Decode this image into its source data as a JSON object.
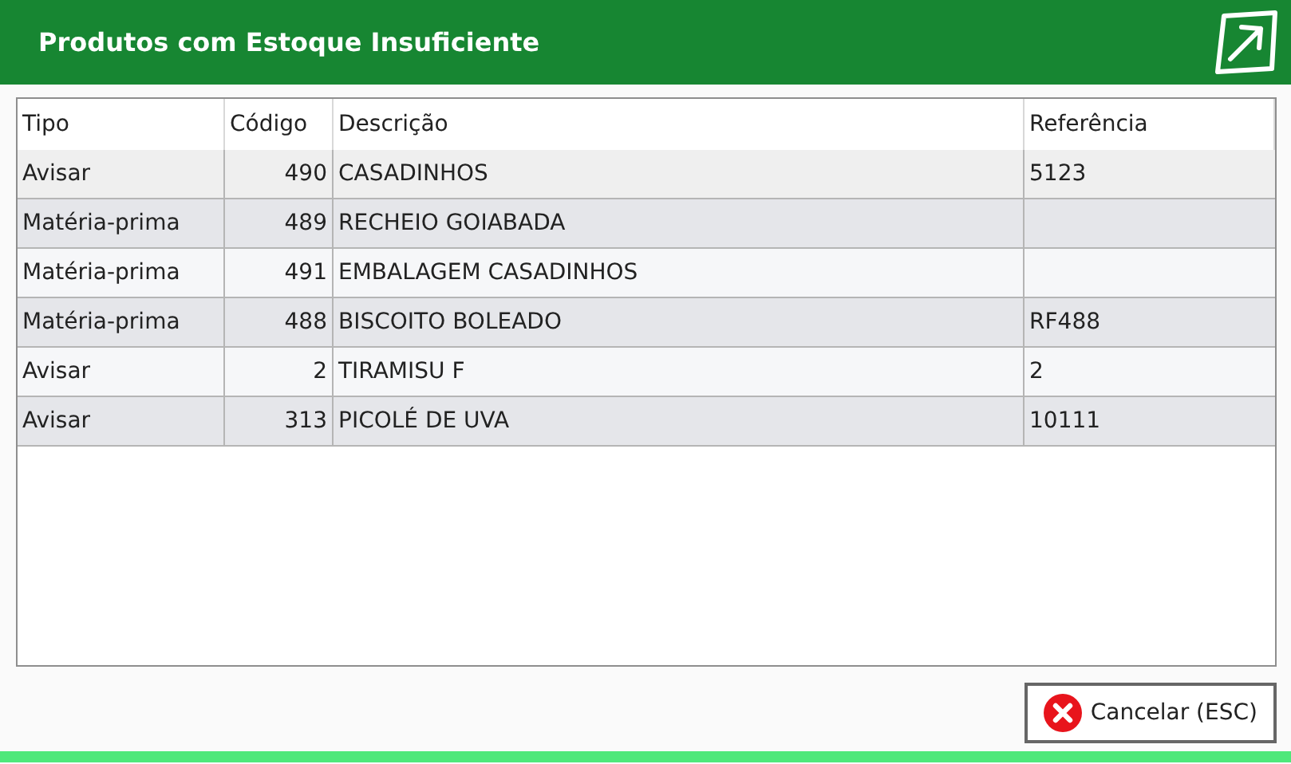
{
  "window": {
    "title": "Produtos com Estoque Insuficiente"
  },
  "table": {
    "columns": [
      "Tipo",
      "Código",
      "Descrição",
      "Referência"
    ],
    "rows": [
      {
        "tipo": "Avisar",
        "codigo": "490",
        "descricao": "CASADINHOS",
        "referencia": "5123"
      },
      {
        "tipo": "Matéria-prima",
        "codigo": "489",
        "descricao": "RECHEIO GOIABADA",
        "referencia": ""
      },
      {
        "tipo": "Matéria-prima",
        "codigo": "491",
        "descricao": "EMBALAGEM CASADINHOS",
        "referencia": ""
      },
      {
        "tipo": "Matéria-prima",
        "codigo": "488",
        "descricao": "BISCOITO BOLEADO",
        "referencia": "RF488"
      },
      {
        "tipo": "Avisar",
        "codigo": "2",
        "descricao": "TIRAMISU F",
        "referencia": "2"
      },
      {
        "tipo": "Avisar",
        "codigo": "313",
        "descricao": "PICOLÉ DE UVA",
        "referencia": "10111"
      }
    ]
  },
  "buttons": [
    {
      "label": "Cancelar (ESC)"
    }
  ]
}
